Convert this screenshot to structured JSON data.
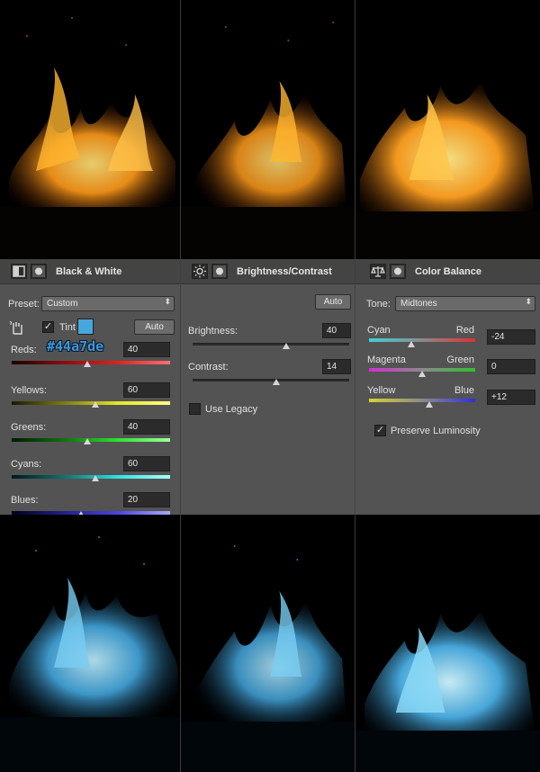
{
  "colors": {
    "panel_bg": "#535353",
    "header_bg": "#444444",
    "tint_color": "#44a7de",
    "flame_orange": "#ff9a1a",
    "flame_blue": "#44a7de"
  },
  "black_white": {
    "title": "Black & White",
    "header_icons": [
      "black-white-adjustment-icon",
      "mask-icon"
    ],
    "preset_label": "Preset:",
    "preset_value": "Custom",
    "tint_label": "Tint",
    "tint_checked": true,
    "tint_hex": "#44a7de",
    "auto_label": "Auto",
    "sliders": [
      {
        "label": "Reds:",
        "value": "40",
        "fraction": 0.48
      },
      {
        "label": "Yellows:",
        "value": "60",
        "fraction": 0.53
      },
      {
        "label": "Greens:",
        "value": "40",
        "fraction": 0.48
      },
      {
        "label": "Cyans:",
        "value": "60",
        "fraction": 0.53
      },
      {
        "label": "Blues:",
        "value": "20",
        "fraction": 0.44
      }
    ]
  },
  "brightness_contrast": {
    "title": "Brightness/Contrast",
    "header_icons": [
      "sun-icon",
      "mask-icon"
    ],
    "auto_label": "Auto",
    "brightness_label": "Brightness:",
    "brightness_value": "40",
    "brightness_fraction": 0.6,
    "contrast_label": "Contrast:",
    "contrast_value": "14",
    "contrast_fraction": 0.535,
    "use_legacy_label": "Use Legacy",
    "use_legacy_checked": false
  },
  "color_balance": {
    "title": "Color Balance",
    "header_icons": [
      "scales-icon",
      "mask-icon"
    ],
    "tone_label": "Tone:",
    "tone_value": "Midtones",
    "sliders": [
      {
        "left": "Cyan",
        "right": "Red",
        "value": "-24",
        "fraction": 0.4
      },
      {
        "left": "Magenta",
        "right": "Green",
        "value": "0",
        "fraction": 0.5
      },
      {
        "left": "Yellow",
        "right": "Blue",
        "value": "+12",
        "fraction": 0.57
      }
    ],
    "preserve_label": "Preserve Luminosity",
    "preserve_checked": true
  }
}
